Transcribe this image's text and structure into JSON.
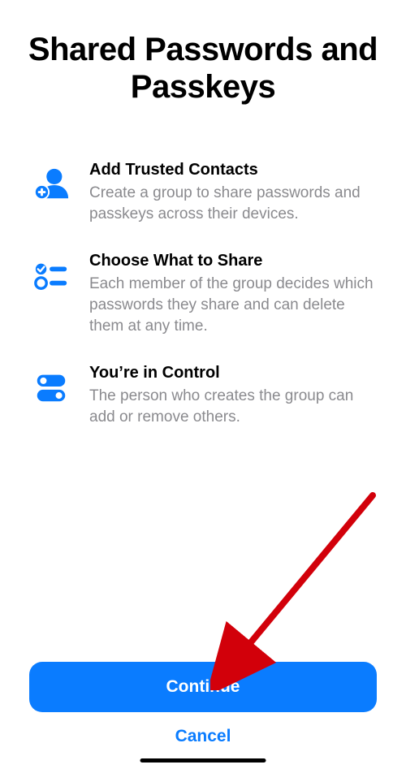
{
  "title": "Shared Passwords and Passkeys",
  "features": [
    {
      "icon": "person-add-icon",
      "title": "Add Trusted Contacts",
      "desc": "Create a group to share passwords and passkeys across their devices."
    },
    {
      "icon": "list-check-icon",
      "title": "Choose What to Share",
      "desc": "Each member of the group decides which passwords they share and can delete them at any time."
    },
    {
      "icon": "toggles-icon",
      "title": "You’re in Control",
      "desc": "The person who creates the group can add or remove others."
    }
  ],
  "buttons": {
    "continue": "Continue",
    "cancel": "Cancel"
  },
  "colors": {
    "accent": "#0a7cff",
    "secondaryText": "#8a8a8e"
  }
}
